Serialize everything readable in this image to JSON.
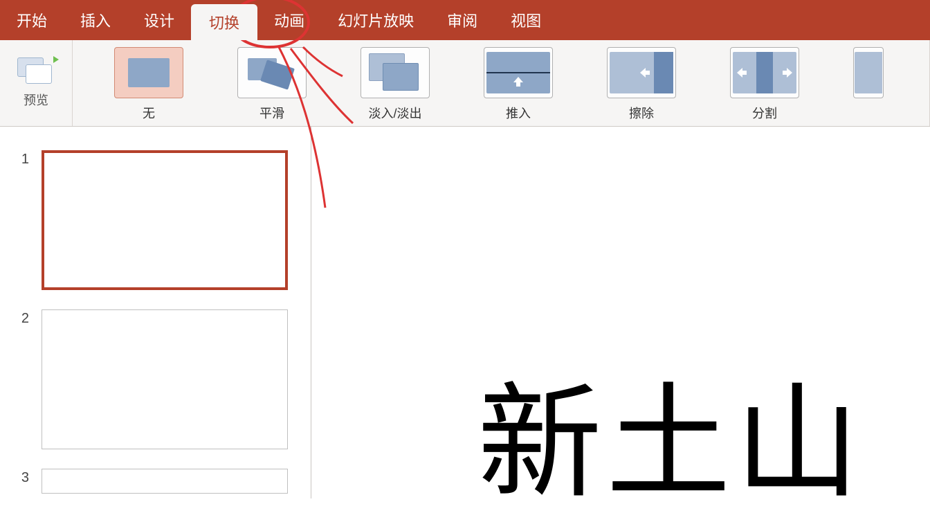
{
  "tabs": {
    "home": "开始",
    "insert": "插入",
    "design": "设计",
    "transitions": "切换",
    "animations": "动画",
    "slideshow": "幻灯片放映",
    "review": "审阅",
    "view": "视图"
  },
  "preview": {
    "label": "预览"
  },
  "transitions_gallery": {
    "none": "无",
    "morph": "平滑",
    "fade": "淡入/淡出",
    "push": "推入",
    "wipe": "擦除",
    "split": "分割"
  },
  "slides": {
    "n1": "1",
    "n2": "2",
    "n3": "3"
  },
  "editor": {
    "partial_text": "新土山"
  },
  "colors": {
    "accent": "#b4402a"
  }
}
